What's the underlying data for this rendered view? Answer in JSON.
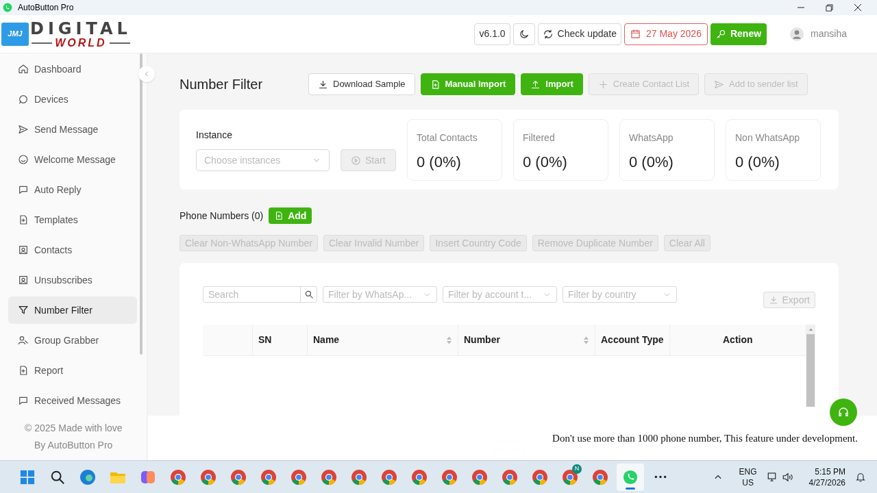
{
  "window": {
    "title": "AutoButton Pro"
  },
  "header": {
    "logo_top": "DIGITAL",
    "logo_bottom": "WORLD",
    "logo_badge": "JMJ",
    "version": "v6.1.0",
    "check_update": "Check update",
    "expiry": "27 May 2026",
    "renew": "Renew",
    "user": "mansiha"
  },
  "sidebar": {
    "items": [
      {
        "label": "Dashboard",
        "selected": false
      },
      {
        "label": "Devices",
        "selected": false
      },
      {
        "label": "Send Message",
        "selected": false
      },
      {
        "label": "Welcome Message",
        "selected": false
      },
      {
        "label": "Auto Reply",
        "selected": false
      },
      {
        "label": "Templates",
        "selected": false
      },
      {
        "label": "Contacts",
        "selected": false
      },
      {
        "label": "Unsubscribes",
        "selected": false
      },
      {
        "label": "Number Filter",
        "selected": true
      },
      {
        "label": "Group Grabber",
        "selected": false
      },
      {
        "label": "Report",
        "selected": false
      },
      {
        "label": "Received Messages",
        "selected": false
      }
    ],
    "footer": [
      "© 2025 Made with love",
      "By AutoButton Pro"
    ]
  },
  "page": {
    "title": "Number Filter",
    "actions": [
      {
        "label": "Download Sample",
        "kind": "outline",
        "disabled": false
      },
      {
        "label": "Manual Import",
        "kind": "primary",
        "disabled": false
      },
      {
        "label": "Import",
        "kind": "primary",
        "disabled": false
      },
      {
        "label": "Create Contact List",
        "kind": "outline",
        "disabled": true
      },
      {
        "label": "Add to sender list",
        "kind": "outline",
        "disabled": true
      }
    ],
    "instance": {
      "label": "Instance",
      "placeholder": "Choose instances",
      "start": "Start",
      "start_disabled": true
    },
    "stats": [
      {
        "label": "Total Contacts",
        "value": "0 (0%)"
      },
      {
        "label": "Filtered",
        "value": "0 (0%)"
      },
      {
        "label": "WhatsApp",
        "value": "0 (0%)"
      },
      {
        "label": "Non WhatsApp",
        "value": "0 (0%)"
      }
    ],
    "phone_numbers": {
      "label": "Phone Numbers (0)",
      "add": "Add"
    },
    "tools": [
      {
        "label": "Clear Non-WhatsApp Number",
        "disabled": true
      },
      {
        "label": "Clear Invalid Number",
        "disabled": true
      },
      {
        "label": "Insert Country Code",
        "disabled": true
      },
      {
        "label": "Remove Duplicate Number",
        "disabled": true
      },
      {
        "label": "Clear All",
        "disabled": true
      }
    ],
    "table": {
      "search_placeholder": "Search",
      "filters": [
        "Filter by WhatsAp...",
        "Filter by account t...",
        "Filter by country"
      ],
      "export": "Export",
      "export_disabled": true,
      "columns": [
        {
          "label": "SN",
          "sortable": false
        },
        {
          "label": "Name",
          "sortable": true
        },
        {
          "label": "Number",
          "sortable": true
        },
        {
          "label": "Account Type",
          "sortable": false
        },
        {
          "label": "Action",
          "sortable": false
        }
      ]
    },
    "notice": "Don't use more than 1000 phone number, This feature under development."
  },
  "taskbar": {
    "apps": [
      {
        "kind": "start",
        "selected": false
      },
      {
        "kind": "search",
        "selected": false
      },
      {
        "kind": "edge",
        "selected": false
      },
      {
        "kind": "files",
        "selected": false
      },
      {
        "kind": "copilot",
        "selected": false
      },
      {
        "kind": "browser",
        "selected": false
      },
      {
        "kind": "browser",
        "selected": false
      },
      {
        "kind": "browser",
        "selected": false
      },
      {
        "kind": "browser",
        "selected": false
      },
      {
        "kind": "browser",
        "selected": false
      },
      {
        "kind": "browser",
        "selected": false
      },
      {
        "kind": "browser",
        "selected": false
      },
      {
        "kind": "browser",
        "selected": false
      },
      {
        "kind": "browser",
        "selected": false
      },
      {
        "kind": "browser",
        "selected": false
      },
      {
        "kind": "browser",
        "selected": false
      },
      {
        "kind": "browser",
        "selected": false
      },
      {
        "kind": "browser",
        "selected": false
      },
      {
        "kind": "browser",
        "badge": "N",
        "selected": false
      },
      {
        "kind": "browser",
        "selected": false
      },
      {
        "kind": "whatsapp",
        "selected": true
      },
      {
        "kind": "more",
        "selected": false
      }
    ],
    "lang": "ENG",
    "region": "US",
    "time": "5:15 PM",
    "date": "4/27/2026"
  }
}
